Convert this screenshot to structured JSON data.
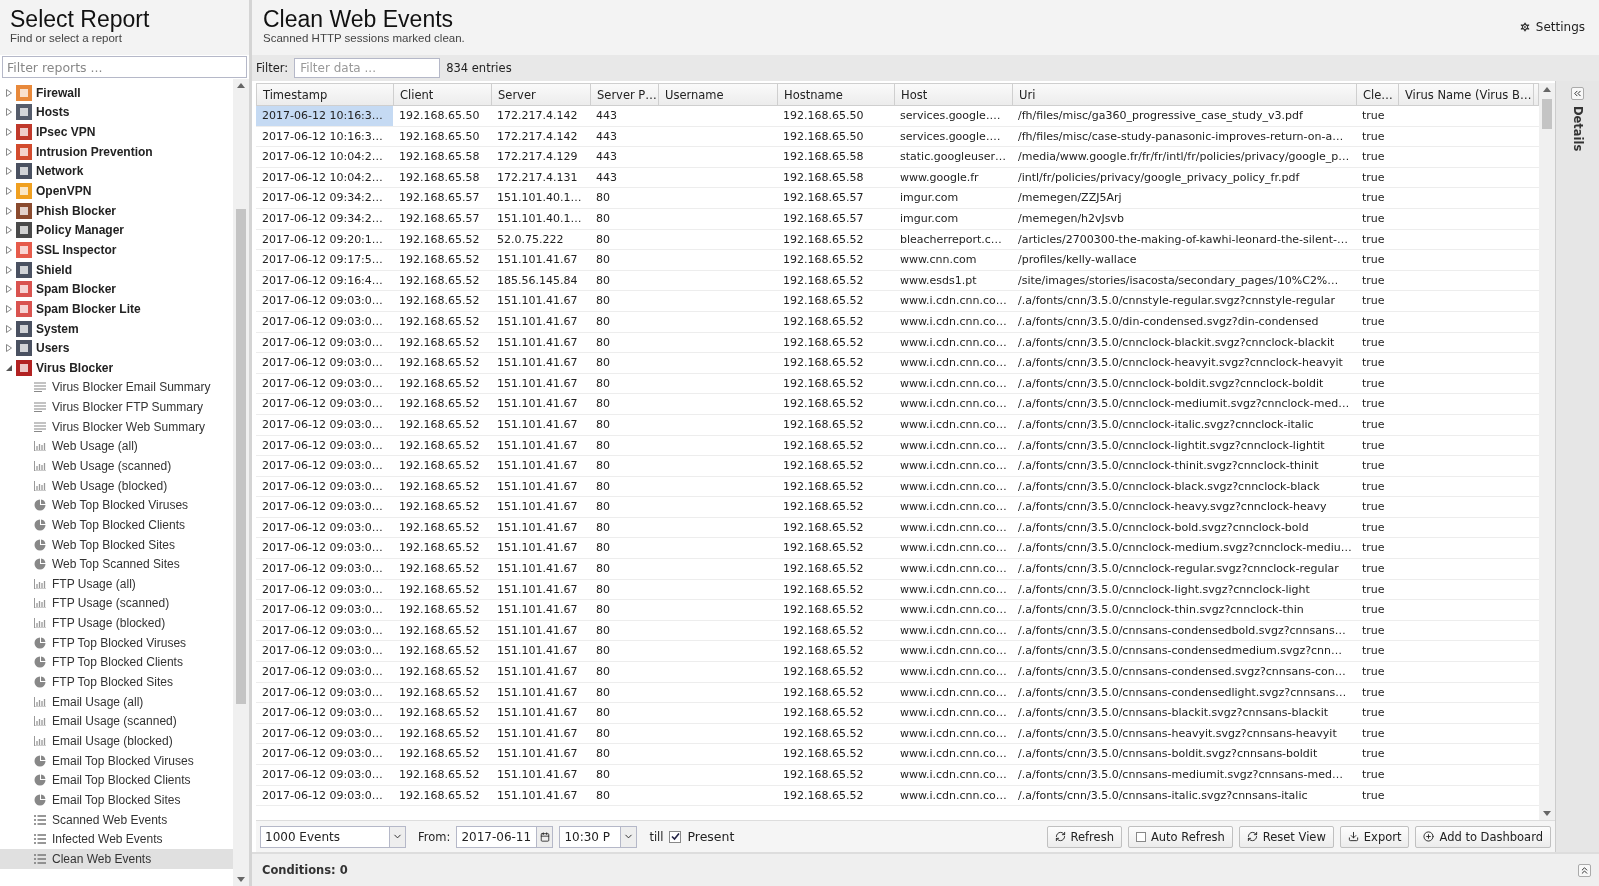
{
  "sidebar": {
    "title": "Select Report",
    "subtitle": "Find or select a report",
    "filter": {
      "placeholder": "Filter reports ..."
    },
    "tree": [
      {
        "label": "Firewall",
        "expanded": false
      },
      {
        "label": "Hosts",
        "expanded": false
      },
      {
        "label": "IPsec VPN",
        "expanded": false
      },
      {
        "label": "Intrusion Prevention",
        "expanded": false
      },
      {
        "label": "Network",
        "expanded": false
      },
      {
        "label": "OpenVPN",
        "expanded": false
      },
      {
        "label": "Phish Blocker",
        "expanded": false
      },
      {
        "label": "Policy Manager",
        "expanded": false
      },
      {
        "label": "SSL Inspector",
        "expanded": false
      },
      {
        "label": "Shield",
        "expanded": false
      },
      {
        "label": "Spam Blocker",
        "expanded": false
      },
      {
        "label": "Spam Blocker Lite",
        "expanded": false
      },
      {
        "label": "System",
        "expanded": false
      },
      {
        "label": "Users",
        "expanded": false
      },
      {
        "label": "Virus Blocker",
        "expanded": true,
        "children": [
          {
            "label": "Virus Blocker Email Summary",
            "kind": "text",
            "selected": false
          },
          {
            "label": "Virus Blocker FTP Summary",
            "kind": "text",
            "selected": false
          },
          {
            "label": "Virus Blocker Web Summary",
            "kind": "text",
            "selected": false
          },
          {
            "label": "Web Usage (all)",
            "kind": "bar",
            "selected": false
          },
          {
            "label": "Web Usage (scanned)",
            "kind": "bar",
            "selected": false
          },
          {
            "label": "Web Usage (blocked)",
            "kind": "bar",
            "selected": false
          },
          {
            "label": "Web Top Blocked Viruses",
            "kind": "pie",
            "selected": false
          },
          {
            "label": "Web Top Blocked Clients",
            "kind": "pie",
            "selected": false
          },
          {
            "label": "Web Top Blocked Sites",
            "kind": "pie",
            "selected": false
          },
          {
            "label": "Web Top Scanned Sites",
            "kind": "pie",
            "selected": false
          },
          {
            "label": "FTP Usage (all)",
            "kind": "bar",
            "selected": false
          },
          {
            "label": "FTP Usage (scanned)",
            "kind": "bar",
            "selected": false
          },
          {
            "label": "FTP Usage (blocked)",
            "kind": "bar",
            "selected": false
          },
          {
            "label": "FTP Top Blocked Viruses",
            "kind": "pie",
            "selected": false
          },
          {
            "label": "FTP Top Blocked Clients",
            "kind": "pie",
            "selected": false
          },
          {
            "label": "FTP Top Blocked Sites",
            "kind": "pie",
            "selected": false
          },
          {
            "label": "Email Usage (all)",
            "kind": "bar",
            "selected": false
          },
          {
            "label": "Email Usage (scanned)",
            "kind": "bar",
            "selected": false
          },
          {
            "label": "Email Usage (blocked)",
            "kind": "bar",
            "selected": false
          },
          {
            "label": "Email Top Blocked Viruses",
            "kind": "pie",
            "selected": false
          },
          {
            "label": "Email Top Blocked Clients",
            "kind": "pie",
            "selected": false
          },
          {
            "label": "Email Top Blocked Sites",
            "kind": "pie",
            "selected": false
          },
          {
            "label": "Scanned Web Events",
            "kind": "list",
            "selected": false
          },
          {
            "label": "Infected Web Events",
            "kind": "list",
            "selected": false
          },
          {
            "label": "Clean Web Events",
            "kind": "list",
            "selected": true
          }
        ]
      }
    ]
  },
  "report": {
    "title": "Clean Web Events",
    "subtitle": "Scanned HTTP sessions marked clean.",
    "settings": "Settings",
    "filter": {
      "label": "Filter:",
      "placeholder": "Filter data ...",
      "count": "834 entries"
    },
    "table": {
      "columns": [
        "Timestamp",
        "Client",
        "Server",
        "Server P…",
        "Username",
        "Hostname",
        "Host",
        "Uri",
        "Cle…",
        "Virus Name (Virus B…"
      ],
      "rows": [
        {
          "selected": true,
          "cells": [
            "2017-06-12 10:16:3…",
            "192.168.65.50",
            "172.217.4.142",
            "443",
            null,
            "192.168.65.50",
            "services.google.…",
            "/fh/files/misc/ga360_progressive_case_study_v3.pdf",
            "true",
            null
          ]
        },
        {
          "selected": false,
          "cells": [
            "2017-06-12 10:16:3…",
            "192.168.65.50",
            "172.217.4.142",
            "443",
            null,
            "192.168.65.50",
            "services.google.…",
            "/fh/files/misc/case-study-panasonic-improves-return-on-a…",
            "true",
            null
          ]
        },
        {
          "selected": false,
          "cells": [
            "2017-06-12 10:04:2…",
            "192.168.65.58",
            "172.217.4.129",
            "443",
            null,
            "192.168.65.58",
            "static.googleuser…",
            "/media/www.google.fr/fr/fr/intl/fr/policies/privacy/google_p…",
            "true",
            null
          ]
        },
        {
          "selected": false,
          "cells": [
            "2017-06-12 10:04:2…",
            "192.168.65.58",
            "172.217.4.131",
            "443",
            null,
            "192.168.65.58",
            "www.google.fr",
            "/intl/fr/policies/privacy/google_privacy_policy_fr.pdf",
            "true",
            null
          ]
        },
        {
          "selected": false,
          "cells": [
            "2017-06-12 09:34:2…",
            "192.168.65.57",
            "151.101.40.1…",
            "80",
            null,
            "192.168.65.57",
            "imgur.com",
            "/memegen/ZZJ5Arj",
            "true",
            null
          ]
        },
        {
          "selected": false,
          "cells": [
            "2017-06-12 09:34:2…",
            "192.168.65.57",
            "151.101.40.1…",
            "80",
            null,
            "192.168.65.57",
            "imgur.com",
            "/memegen/h2vJsvb",
            "true",
            null
          ]
        },
        {
          "selected": false,
          "cells": [
            "2017-06-12 09:20:1…",
            "192.168.65.52",
            "52.0.75.222",
            "80",
            null,
            "192.168.65.52",
            "bleacherreport.c…",
            "/articles/2700300-the-making-of-kawhi-leonard-the-silent-…",
            "true",
            null
          ]
        },
        {
          "selected": false,
          "cells": [
            "2017-06-12 09:17:5…",
            "192.168.65.52",
            "151.101.41.67",
            "80",
            null,
            "192.168.65.52",
            "www.cnn.com",
            "/profiles/kelly-wallace",
            "true",
            null
          ]
        },
        {
          "selected": false,
          "cells": [
            "2017-06-12 09:16:4…",
            "192.168.65.52",
            "185.56.145.84",
            "80",
            null,
            "192.168.65.52",
            "www.esds1.pt",
            "/site/images/stories/isacosta/secondary_pages/10%C2%…",
            "true",
            null
          ]
        },
        {
          "selected": false,
          "cells": [
            "2017-06-12 09:03:0…",
            "192.168.65.52",
            "151.101.41.67",
            "80",
            null,
            "192.168.65.52",
            "www.i.cdn.cnn.co…",
            "/.a/fonts/cnn/3.5.0/cnnstyle-regular.svgz?cnnstyle-regular",
            "true",
            null
          ]
        },
        {
          "selected": false,
          "cells": [
            "2017-06-12 09:03:0…",
            "192.168.65.52",
            "151.101.41.67",
            "80",
            null,
            "192.168.65.52",
            "www.i.cdn.cnn.co…",
            "/.a/fonts/cnn/3.5.0/din-condensed.svgz?din-condensed",
            "true",
            null
          ]
        },
        {
          "selected": false,
          "cells": [
            "2017-06-12 09:03:0…",
            "192.168.65.52",
            "151.101.41.67",
            "80",
            null,
            "192.168.65.52",
            "www.i.cdn.cnn.co…",
            "/.a/fonts/cnn/3.5.0/cnnclock-blackit.svgz?cnnclock-blackit",
            "true",
            null
          ]
        },
        {
          "selected": false,
          "cells": [
            "2017-06-12 09:03:0…",
            "192.168.65.52",
            "151.101.41.67",
            "80",
            null,
            "192.168.65.52",
            "www.i.cdn.cnn.co…",
            "/.a/fonts/cnn/3.5.0/cnnclock-heavyit.svgz?cnnclock-heavyit",
            "true",
            null
          ]
        },
        {
          "selected": false,
          "cells": [
            "2017-06-12 09:03:0…",
            "192.168.65.52",
            "151.101.41.67",
            "80",
            null,
            "192.168.65.52",
            "www.i.cdn.cnn.co…",
            "/.a/fonts/cnn/3.5.0/cnnclock-boldit.svgz?cnnclock-boldit",
            "true",
            null
          ]
        },
        {
          "selected": false,
          "cells": [
            "2017-06-12 09:03:0…",
            "192.168.65.52",
            "151.101.41.67",
            "80",
            null,
            "192.168.65.52",
            "www.i.cdn.cnn.co…",
            "/.a/fonts/cnn/3.5.0/cnnclock-mediumit.svgz?cnnclock-med…",
            "true",
            null
          ]
        },
        {
          "selected": false,
          "cells": [
            "2017-06-12 09:03:0…",
            "192.168.65.52",
            "151.101.41.67",
            "80",
            null,
            "192.168.65.52",
            "www.i.cdn.cnn.co…",
            "/.a/fonts/cnn/3.5.0/cnnclock-italic.svgz?cnnclock-italic",
            "true",
            null
          ]
        },
        {
          "selected": false,
          "cells": [
            "2017-06-12 09:03:0…",
            "192.168.65.52",
            "151.101.41.67",
            "80",
            null,
            "192.168.65.52",
            "www.i.cdn.cnn.co…",
            "/.a/fonts/cnn/3.5.0/cnnclock-lightit.svgz?cnnclock-lightit",
            "true",
            null
          ]
        },
        {
          "selected": false,
          "cells": [
            "2017-06-12 09:03:0…",
            "192.168.65.52",
            "151.101.41.67",
            "80",
            null,
            "192.168.65.52",
            "www.i.cdn.cnn.co…",
            "/.a/fonts/cnn/3.5.0/cnnclock-thinit.svgz?cnnclock-thinit",
            "true",
            null
          ]
        },
        {
          "selected": false,
          "cells": [
            "2017-06-12 09:03:0…",
            "192.168.65.52",
            "151.101.41.67",
            "80",
            null,
            "192.168.65.52",
            "www.i.cdn.cnn.co…",
            "/.a/fonts/cnn/3.5.0/cnnclock-black.svgz?cnnclock-black",
            "true",
            null
          ]
        },
        {
          "selected": false,
          "cells": [
            "2017-06-12 09:03:0…",
            "192.168.65.52",
            "151.101.41.67",
            "80",
            null,
            "192.168.65.52",
            "www.i.cdn.cnn.co…",
            "/.a/fonts/cnn/3.5.0/cnnclock-heavy.svgz?cnnclock-heavy",
            "true",
            null
          ]
        },
        {
          "selected": false,
          "cells": [
            "2017-06-12 09:03:0…",
            "192.168.65.52",
            "151.101.41.67",
            "80",
            null,
            "192.168.65.52",
            "www.i.cdn.cnn.co…",
            "/.a/fonts/cnn/3.5.0/cnnclock-bold.svgz?cnnclock-bold",
            "true",
            null
          ]
        },
        {
          "selected": false,
          "cells": [
            "2017-06-12 09:03:0…",
            "192.168.65.52",
            "151.101.41.67",
            "80",
            null,
            "192.168.65.52",
            "www.i.cdn.cnn.co…",
            "/.a/fonts/cnn/3.5.0/cnnclock-medium.svgz?cnnclock-mediu…",
            "true",
            null
          ]
        },
        {
          "selected": false,
          "cells": [
            "2017-06-12 09:03:0…",
            "192.168.65.52",
            "151.101.41.67",
            "80",
            null,
            "192.168.65.52",
            "www.i.cdn.cnn.co…",
            "/.a/fonts/cnn/3.5.0/cnnclock-regular.svgz?cnnclock-regular",
            "true",
            null
          ]
        },
        {
          "selected": false,
          "cells": [
            "2017-06-12 09:03:0…",
            "192.168.65.52",
            "151.101.41.67",
            "80",
            null,
            "192.168.65.52",
            "www.i.cdn.cnn.co…",
            "/.a/fonts/cnn/3.5.0/cnnclock-light.svgz?cnnclock-light",
            "true",
            null
          ]
        },
        {
          "selected": false,
          "cells": [
            "2017-06-12 09:03:0…",
            "192.168.65.52",
            "151.101.41.67",
            "80",
            null,
            "192.168.65.52",
            "www.i.cdn.cnn.co…",
            "/.a/fonts/cnn/3.5.0/cnnclock-thin.svgz?cnnclock-thin",
            "true",
            null
          ]
        },
        {
          "selected": false,
          "cells": [
            "2017-06-12 09:03:0…",
            "192.168.65.52",
            "151.101.41.67",
            "80",
            null,
            "192.168.65.52",
            "www.i.cdn.cnn.co…",
            "/.a/fonts/cnn/3.5.0/cnnsans-condensedbold.svgz?cnnsans…",
            "true",
            null
          ]
        },
        {
          "selected": false,
          "cells": [
            "2017-06-12 09:03:0…",
            "192.168.65.52",
            "151.101.41.67",
            "80",
            null,
            "192.168.65.52",
            "www.i.cdn.cnn.co…",
            "/.a/fonts/cnn/3.5.0/cnnsans-condensedmedium.svgz?cnn…",
            "true",
            null
          ]
        },
        {
          "selected": false,
          "cells": [
            "2017-06-12 09:03:0…",
            "192.168.65.52",
            "151.101.41.67",
            "80",
            null,
            "192.168.65.52",
            "www.i.cdn.cnn.co…",
            "/.a/fonts/cnn/3.5.0/cnnsans-condensed.svgz?cnnsans-con…",
            "true",
            null
          ]
        },
        {
          "selected": false,
          "cells": [
            "2017-06-12 09:03:0…",
            "192.168.65.52",
            "151.101.41.67",
            "80",
            null,
            "192.168.65.52",
            "www.i.cdn.cnn.co…",
            "/.a/fonts/cnn/3.5.0/cnnsans-condensedlight.svgz?cnnsans…",
            "true",
            null
          ]
        },
        {
          "selected": false,
          "cells": [
            "2017-06-12 09:03:0…",
            "192.168.65.52",
            "151.101.41.67",
            "80",
            null,
            "192.168.65.52",
            "www.i.cdn.cnn.co…",
            "/.a/fonts/cnn/3.5.0/cnnsans-blackit.svgz?cnnsans-blackit",
            "true",
            null
          ]
        },
        {
          "selected": false,
          "cells": [
            "2017-06-12 09:03:0…",
            "192.168.65.52",
            "151.101.41.67",
            "80",
            null,
            "192.168.65.52",
            "www.i.cdn.cnn.co…",
            "/.a/fonts/cnn/3.5.0/cnnsans-heavyit.svgz?cnnsans-heavyit",
            "true",
            null
          ]
        },
        {
          "selected": false,
          "cells": [
            "2017-06-12 09:03:0…",
            "192.168.65.52",
            "151.101.41.67",
            "80",
            null,
            "192.168.65.52",
            "www.i.cdn.cnn.co…",
            "/.a/fonts/cnn/3.5.0/cnnsans-boldit.svgz?cnnsans-boldit",
            "true",
            null
          ]
        },
        {
          "selected": false,
          "cells": [
            "2017-06-12 09:03:0…",
            "192.168.65.52",
            "151.101.41.67",
            "80",
            null,
            "192.168.65.52",
            "www.i.cdn.cnn.co…",
            "/.a/fonts/cnn/3.5.0/cnnsans-mediumit.svgz?cnnsans-med…",
            "true",
            null
          ]
        },
        {
          "selected": false,
          "cells": [
            "2017-06-12 09:03:0…",
            "192.168.65.52",
            "151.101.41.67",
            "80",
            null,
            "192.168.65.52",
            "www.i.cdn.cnn.co…",
            "/.a/fonts/cnn/3.5.0/cnnsans-italic.svgz?cnnsans-italic",
            "true",
            null
          ]
        }
      ]
    },
    "toolbar": {
      "limit": "1000 Events",
      "from_label": "From:",
      "date": "2017-06-11",
      "time": "10:30 P",
      "till_label": "till",
      "present": {
        "label": "Present",
        "checked": true
      },
      "buttons": [
        "Refresh",
        "Auto Refresh",
        "Reset View",
        "Export",
        "Add to Dashboard"
      ],
      "auto_refresh_checked": false
    },
    "conditions": "Conditions: 0",
    "details": "Details"
  }
}
